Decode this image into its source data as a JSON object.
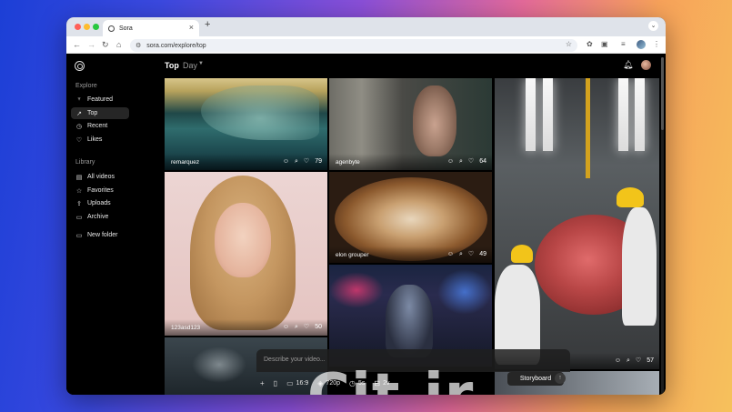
{
  "browser": {
    "tab_title": "Sora",
    "url": "sora.com/explore/top",
    "new_tab_glyph": "+",
    "tab_close_glyph": "×"
  },
  "sidebar": {
    "explore_heading": "Explore",
    "explore_items": [
      {
        "label": "Featured",
        "icon": "featured-icon"
      },
      {
        "label": "Top",
        "icon": "top-icon",
        "active": true
      },
      {
        "label": "Recent",
        "icon": "recent-icon"
      },
      {
        "label": "Likes",
        "icon": "heart-icon"
      }
    ],
    "library_heading": "Library",
    "library_items": [
      {
        "label": "All videos",
        "icon": "videos-icon"
      },
      {
        "label": "Favorites",
        "icon": "star-icon"
      },
      {
        "label": "Uploads",
        "icon": "upload-icon"
      },
      {
        "label": "Archive",
        "icon": "archive-icon"
      }
    ],
    "new_folder": "New folder"
  },
  "header": {
    "title": "Top",
    "period": "Day"
  },
  "tiles": [
    {
      "user": "remarquez",
      "likes": "79"
    },
    {
      "user": "agenbyte",
      "likes": "64"
    },
    {
      "user": "",
      "likes": "57"
    },
    {
      "user": "123asd123",
      "likes": "50"
    },
    {
      "user": "elon grouper",
      "likes": "49"
    },
    {
      "user": "",
      "likes": ""
    }
  ],
  "composer": {
    "placeholder": "Describe your video...",
    "aspect": "16:9",
    "resolution": "720p",
    "duration": "5s",
    "variations": "2v",
    "storyboard": "Storyboard"
  },
  "watermark": "Cit.ir",
  "colors": {
    "app_bg": "#000000",
    "sidebar_active": "#262626",
    "chrome_tabbar": "#dfe3ea",
    "traffic_red": "#ff5f57",
    "traffic_yellow": "#febc2e",
    "traffic_green": "#28c840"
  }
}
